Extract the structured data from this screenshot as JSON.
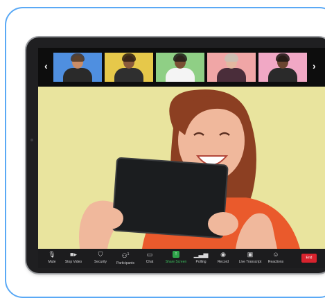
{
  "strip": {
    "prev_icon": "chevron-left-icon",
    "next_icon": "chevron-right-icon",
    "participants": [
      {
        "bg": "#4f8fe0",
        "skin": "#c98c66",
        "shirt": "#2a2a2a",
        "hair": "#4a3523"
      },
      {
        "bg": "#e6c84a",
        "skin": "#8a5a3c",
        "shirt": "#2f2f2f",
        "hair": "#2a1c12"
      },
      {
        "bg": "#8fcf85",
        "skin": "#7a4f33",
        "shirt": "#f4f4f4",
        "hair": "#1f1a17"
      },
      {
        "bg": "#f0a6a6",
        "skin": "#e3b8a0",
        "shirt": "#4a2d3a",
        "hair": "#c9c0b5"
      },
      {
        "bg": "#f1a8c5",
        "skin": "#6b4530",
        "shirt": "#2a2a2a",
        "hair": "#1a1410"
      }
    ]
  },
  "speaker": {
    "background": "#e9e49e",
    "hair": "#8c3f22",
    "skin": "#f0b89c",
    "shirt": "#ea5a2c",
    "tablet": "#1b1d1f"
  },
  "toolbar": {
    "mute": {
      "label": "Mute",
      "icon": "microphone-icon"
    },
    "stop_video": {
      "label": "Stop Video",
      "icon": "video-camera-icon"
    },
    "security": {
      "label": "Security",
      "icon": "shield-icon"
    },
    "participants": {
      "label": "Participants",
      "count": "1",
      "icon": "participants-icon"
    },
    "chat": {
      "label": "Chat",
      "icon": "chat-icon"
    },
    "share_screen": {
      "label": "Share Screen",
      "icon": "share-screen-icon"
    },
    "polling": {
      "label": "Polling",
      "icon": "bar-chart-icon"
    },
    "record": {
      "label": "Record",
      "icon": "record-icon"
    },
    "live_transcript": {
      "label": "Live Transcript",
      "icon": "cc-icon"
    },
    "reactions": {
      "label": "Reactions",
      "icon": "emoji-icon"
    },
    "end": {
      "label": "End"
    }
  },
  "colors": {
    "card_border": "#5aa9f5",
    "share_green": "#2ea34a",
    "end_red": "#d9232e"
  }
}
